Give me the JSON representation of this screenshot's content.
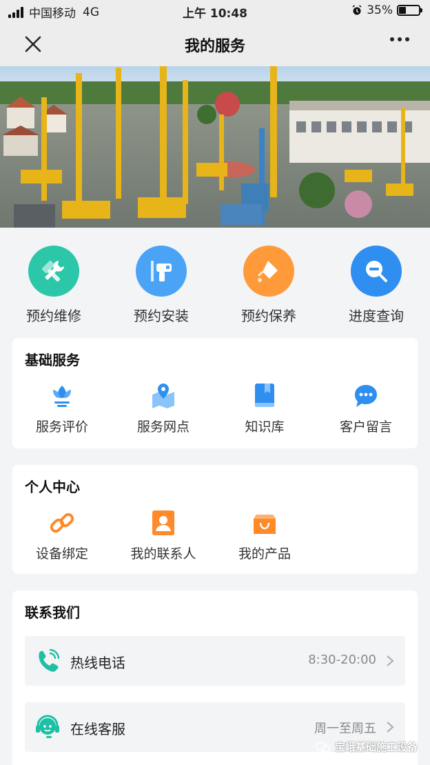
{
  "status_bar": {
    "carrier": "中国移动",
    "network": "4G",
    "time": "上午 10:48",
    "battery": "35%",
    "battery_level": 0.35
  },
  "nav": {
    "title": "我的服务",
    "close_icon": "close-icon",
    "more_icon": "more-icon"
  },
  "quick_actions": [
    {
      "label": "预约维修",
      "icon": "repair-tools-icon",
      "color": "#2bc7a8"
    },
    {
      "label": "预约安装",
      "icon": "drill-icon",
      "color": "#4aa3f5"
    },
    {
      "label": "预约保养",
      "icon": "oil-can-icon",
      "color": "#ff9a3a"
    },
    {
      "label": "进度查询",
      "icon": "search-progress-icon",
      "color": "#2f8ff0"
    }
  ],
  "basic_services": {
    "title": "基础服务",
    "items": [
      {
        "label": "服务评价",
        "icon": "tulip-icon"
      },
      {
        "label": "服务网点",
        "icon": "map-pin-icon"
      },
      {
        "label": "知识库",
        "icon": "book-icon"
      },
      {
        "label": "客户留言",
        "icon": "chat-bubble-icon"
      }
    ]
  },
  "personal_center": {
    "title": "个人中心",
    "items": [
      {
        "label": "设备绑定",
        "icon": "link-icon"
      },
      {
        "label": "我的联系人",
        "icon": "contact-card-icon"
      },
      {
        "label": "我的产品",
        "icon": "shopping-bag-icon"
      }
    ]
  },
  "contact_us": {
    "title": "联系我们",
    "rows": [
      {
        "label": "热线电话",
        "value": "8:30-20:00",
        "icon": "phone-icon"
      },
      {
        "label": "在线客服",
        "value": "周一至周五",
        "icon": "headset-icon"
      }
    ]
  },
  "watermark": "宝峨基础施工设备",
  "colors": {
    "accent_blue": "#2f8ff0",
    "accent_orange": "#ff8a2a",
    "teal": "#2bc7a8"
  }
}
